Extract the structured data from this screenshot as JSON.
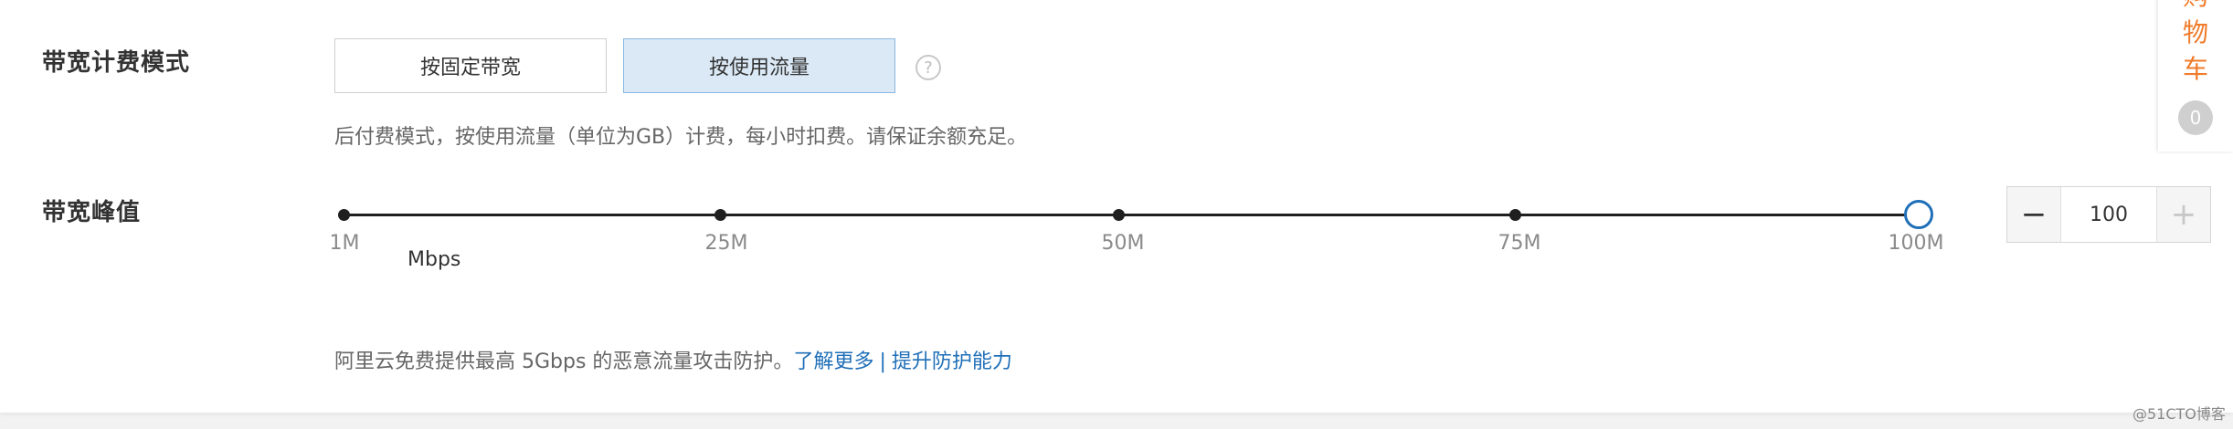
{
  "billing": {
    "label": "带宽计费模式",
    "options": [
      "按固定带宽",
      "按使用流量"
    ],
    "selected": "按使用流量",
    "help_icon": "?",
    "description": "后付费模式，按使用流量（单位为GB）计费，每小时扣费。请保证余额充足。"
  },
  "peak": {
    "label": "带宽峰值",
    "ticks": [
      "1M",
      "25M",
      "50M",
      "75M",
      "100M"
    ],
    "unit": "Mbps",
    "min": 1,
    "max": 100,
    "value": "100",
    "minus_symbol": "−",
    "plus_symbol": "+"
  },
  "protection": {
    "text": "阿里云免费提供最高 5Gbps 的恶意流量攻击防护。",
    "link_more": "了解更多",
    "separator": "|",
    "link_upgrade": "提升防护能力"
  },
  "cart": {
    "text": "购物车",
    "count": "0"
  },
  "watermark": "@51CTO博客",
  "colors": {
    "accent_blue": "#1f6fb8",
    "selected_bg": "#dbe9f6",
    "cart_orange": "#f07b2a"
  }
}
